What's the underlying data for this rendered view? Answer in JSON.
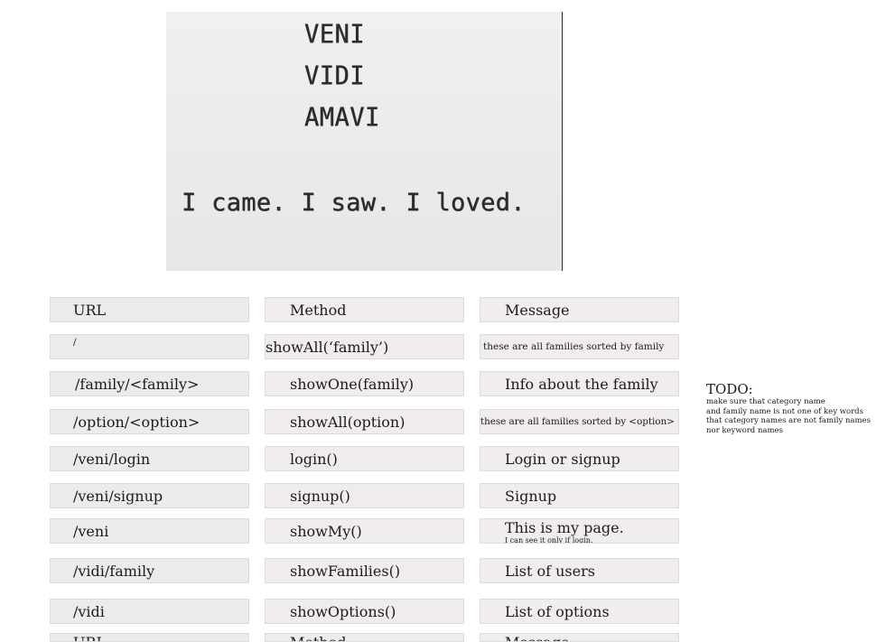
{
  "photo": {
    "words": [
      "VENI",
      "VIDI",
      "AMAVI"
    ],
    "caption": "I came. I saw. I loved."
  },
  "table": {
    "header": {
      "url": "URL",
      "method": "Method",
      "message": "Message"
    },
    "rows": [
      {
        "url": "/",
        "method": "showAll(‘family’)",
        "message": "these are all families sorted by family"
      },
      {
        "url": "/family/<family>",
        "method": "showOne(family)",
        "message": "Info about the family"
      },
      {
        "url": "/option/<option>",
        "method": "showAll(option)",
        "message": "these are all families sorted by <option>"
      },
      {
        "url": "/veni/login",
        "method": "login()",
        "message": "Login or signup"
      },
      {
        "url": "/veni/signup",
        "method": "signup()",
        "message": "Signup"
      },
      {
        "url": "/veni",
        "method": "showMy()",
        "message": "This is my page.",
        "message_note": "I can see it only if login."
      },
      {
        "url": "/vidi/family",
        "method": "showFamilies()",
        "message": "List of users"
      },
      {
        "url": "/vidi",
        "method": "showOptions()",
        "message": "List of options"
      }
    ],
    "footer": {
      "url": "URL",
      "method": "Method",
      "message": "Message"
    }
  },
  "todo": {
    "title": "TODO:",
    "lines": [
      "make sure that category name",
      "and family name is not one of key words",
      "that category names are not family names",
      "nor keyword names"
    ]
  }
}
